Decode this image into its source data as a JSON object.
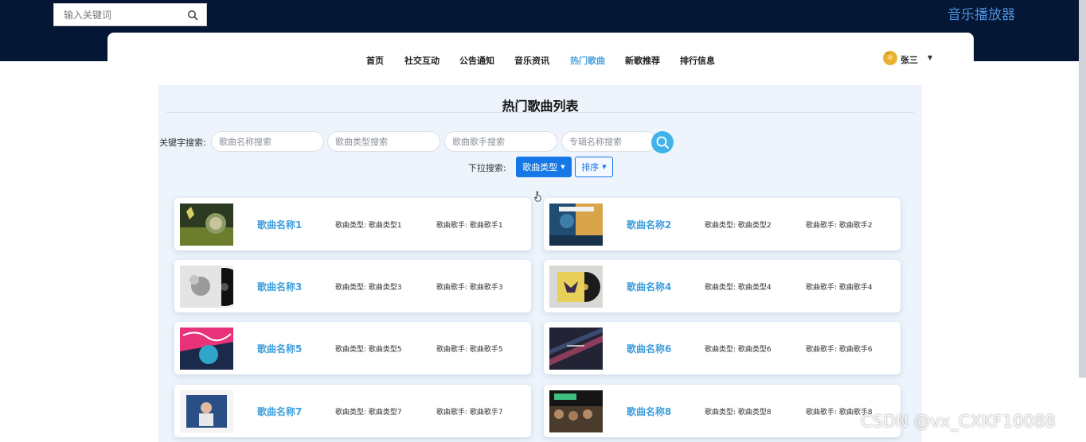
{
  "header": {
    "search_placeholder": "输入关键词",
    "brand": "音乐播放器"
  },
  "nav": {
    "items": [
      {
        "label": "首页",
        "active": false
      },
      {
        "label": "社交互动",
        "active": false
      },
      {
        "label": "公告通知",
        "active": false
      },
      {
        "label": "音乐资讯",
        "active": false
      },
      {
        "label": "热门歌曲",
        "active": true
      },
      {
        "label": "新歌推荐",
        "active": false
      },
      {
        "label": "排行信息",
        "active": false
      }
    ],
    "user_name": "张三"
  },
  "main": {
    "title": "热门歌曲列表",
    "keyword_label": "关键字搜索:",
    "search_placeholders": [
      "歌曲名称搜索",
      "歌曲类型搜索",
      "歌曲歌手搜索",
      "专辑名称搜索"
    ],
    "dropdown_label": "下拉搜索:",
    "dropdown_type": "歌曲类型",
    "dropdown_sort": "排序"
  },
  "songs": [
    {
      "name": "歌曲名称1",
      "type": "歌曲类型: 歌曲类型1",
      "singer": "歌曲歌手: 歌曲歌手1"
    },
    {
      "name": "歌曲名称2",
      "type": "歌曲类型: 歌曲类型2",
      "singer": "歌曲歌手: 歌曲歌手2"
    },
    {
      "name": "歌曲名称3",
      "type": "歌曲类型: 歌曲类型3",
      "singer": "歌曲歌手: 歌曲歌手3"
    },
    {
      "name": "歌曲名称4",
      "type": "歌曲类型: 歌曲类型4",
      "singer": "歌曲歌手: 歌曲歌手4"
    },
    {
      "name": "歌曲名称5",
      "type": "歌曲类型: 歌曲类型5",
      "singer": "歌曲歌手: 歌曲歌手5"
    },
    {
      "name": "歌曲名称6",
      "type": "歌曲类型: 歌曲类型6",
      "singer": "歌曲歌手: 歌曲歌手6"
    },
    {
      "name": "歌曲名称7",
      "type": "歌曲类型: 歌曲类型7",
      "singer": "歌曲歌手: 歌曲歌手7"
    },
    {
      "name": "歌曲名称8",
      "type": "歌曲类型: 歌曲类型8",
      "singer": "歌曲歌手: 歌曲歌手8"
    }
  ],
  "watermark": "CSDN @vx_CXKF10088",
  "colors": {
    "header_bg": "#061635",
    "accent": "#4aa3df",
    "primary_button": "#1677e6",
    "search_button": "#41b3ea"
  }
}
